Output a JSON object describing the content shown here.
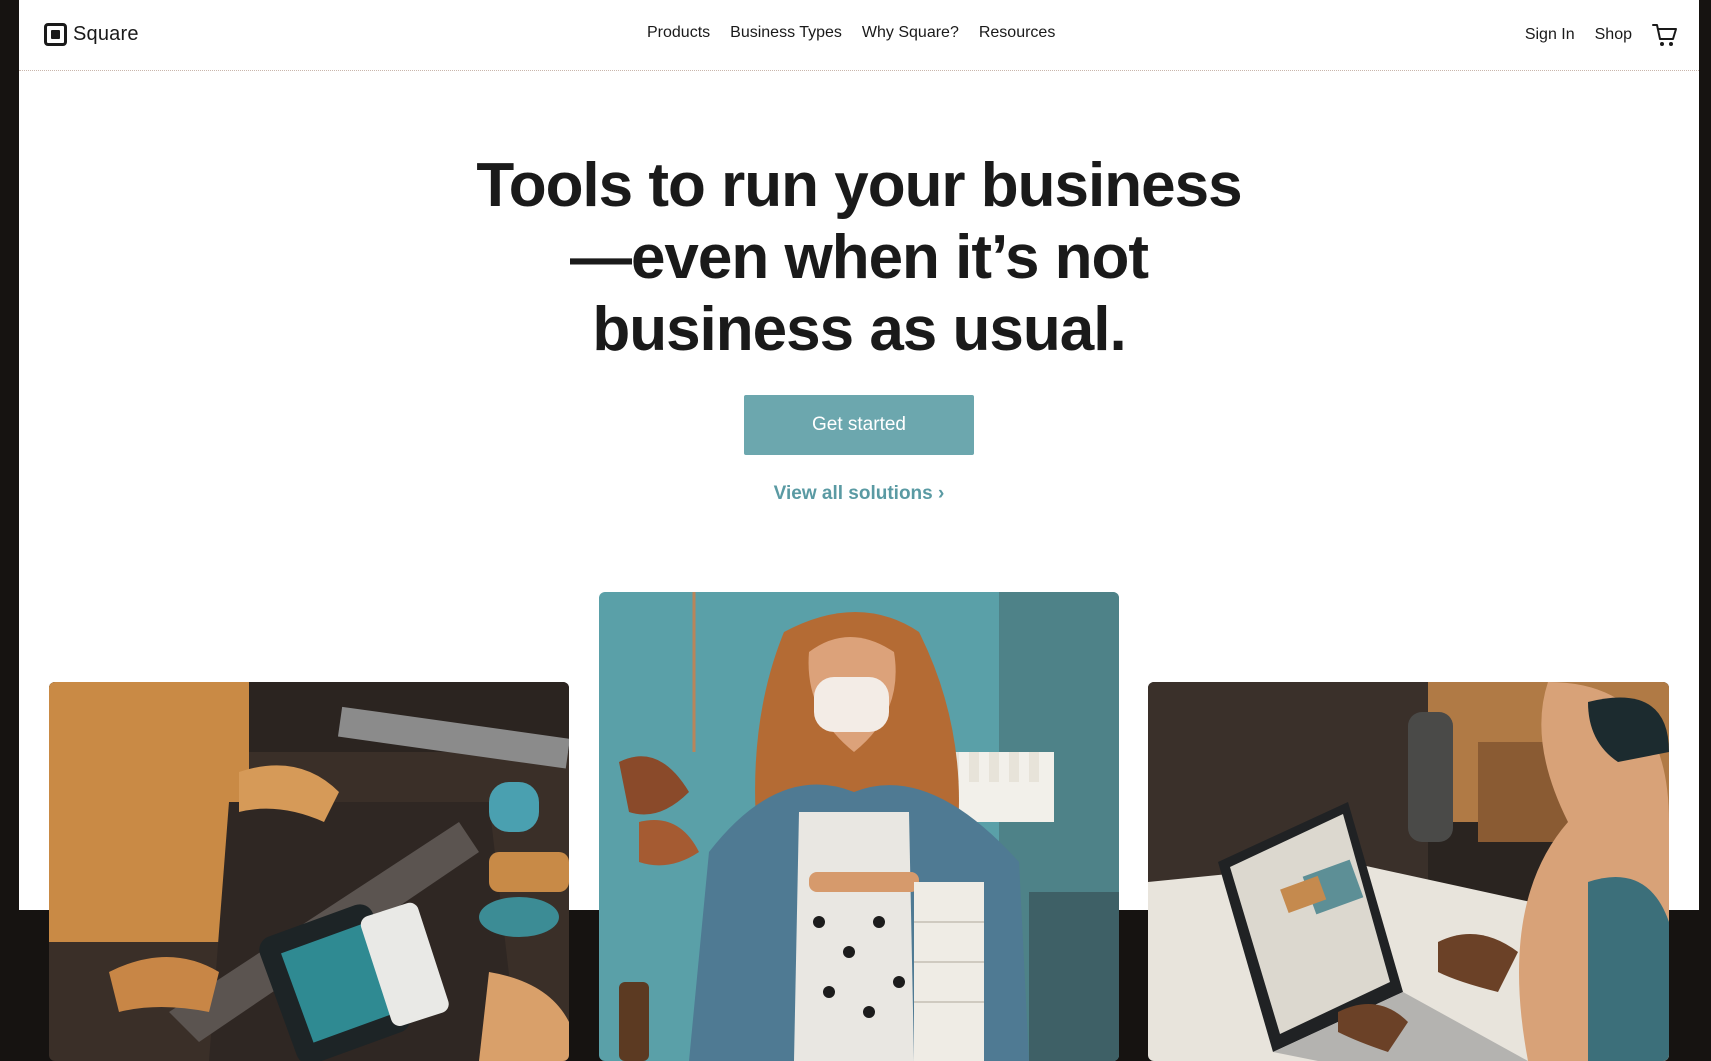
{
  "header": {
    "logo_text": "Square",
    "nav": [
      "Products",
      "Business Types",
      "Why Square?",
      "Resources"
    ],
    "sign_in": "Sign In",
    "shop": "Shop"
  },
  "hero": {
    "title": "Tools to run your business—even when it’s not business as usual.",
    "cta": "Get started",
    "link": "View all solutions ›"
  },
  "icons": {
    "logo": "square-logo-icon",
    "cart": "cart-icon"
  },
  "colors": {
    "accent": "#6ca7ae",
    "link": "#5a9aa3",
    "text": "#1a1a1a",
    "frame": "#161311"
  }
}
